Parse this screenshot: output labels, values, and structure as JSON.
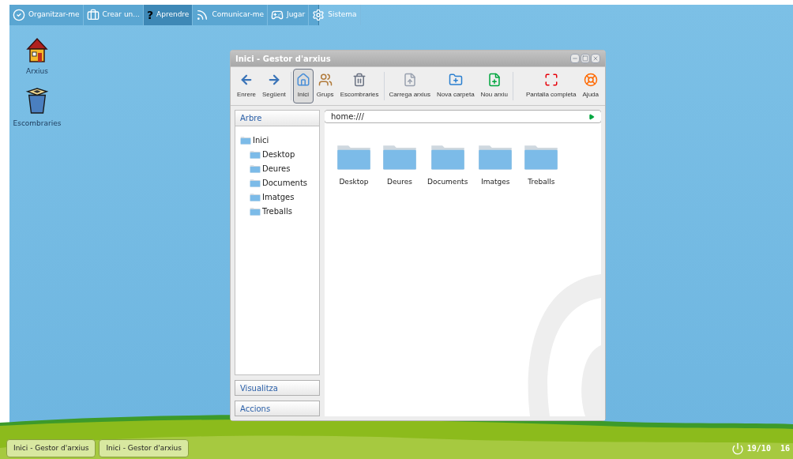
{
  "top_menu": [
    {
      "label": "Organitzar-me",
      "selected": false
    },
    {
      "label": "Crear un...",
      "selected": false
    },
    {
      "glyph": "?",
      "label": "Aprendre",
      "selected": true
    },
    {
      "label": "Comunicar-me",
      "selected": false
    },
    {
      "label": "Jugar",
      "selected": false
    },
    {
      "label": "Sistema",
      "selected": false
    }
  ],
  "desktop_icons": [
    {
      "label": "Arxius"
    },
    {
      "label": "Escombraries"
    }
  ],
  "window": {
    "title": "Inici - Gestor d'arxius",
    "toolbar_groups": [
      {
        "buttons": [
          {
            "label": "Enrere",
            "selected": false
          },
          {
            "label": "Següent",
            "selected": false
          }
        ]
      },
      {
        "buttons": [
          {
            "label": "Inici",
            "selected": true
          },
          {
            "label": "Grups",
            "selected": false
          },
          {
            "label": "Escombraries",
            "selected": false
          }
        ]
      },
      {
        "buttons": [
          {
            "label": "Carrega arxius",
            "selected": false
          },
          {
            "label": "Nova carpeta",
            "selected": false
          },
          {
            "label": "Nou arxiu",
            "selected": false
          }
        ]
      }
    ],
    "toolbar_right": [
      {
        "label": "Pantalla completa",
        "selected": false
      },
      {
        "label": "Ajuda",
        "selected": false
      }
    ],
    "sidebar": {
      "tree_title": "Arbre",
      "tree": [
        {
          "label": "Inici",
          "children": [
            {
              "label": "Desktop"
            },
            {
              "label": "Deures"
            },
            {
              "label": "Documents"
            },
            {
              "label": "Imatges"
            },
            {
              "label": "Treballs"
            }
          ]
        }
      ],
      "sections": [
        "Visualitza",
        "Accions"
      ]
    },
    "address": "home:///",
    "folders": [
      "Desktop",
      "Deures",
      "Documents",
      "Imatges",
      "Treballs"
    ]
  },
  "taskbar": {
    "tasks": [
      "Inici - Gestor d'arxius",
      "Inici - Gestor d'arxius"
    ],
    "clock": "19/10  16"
  }
}
